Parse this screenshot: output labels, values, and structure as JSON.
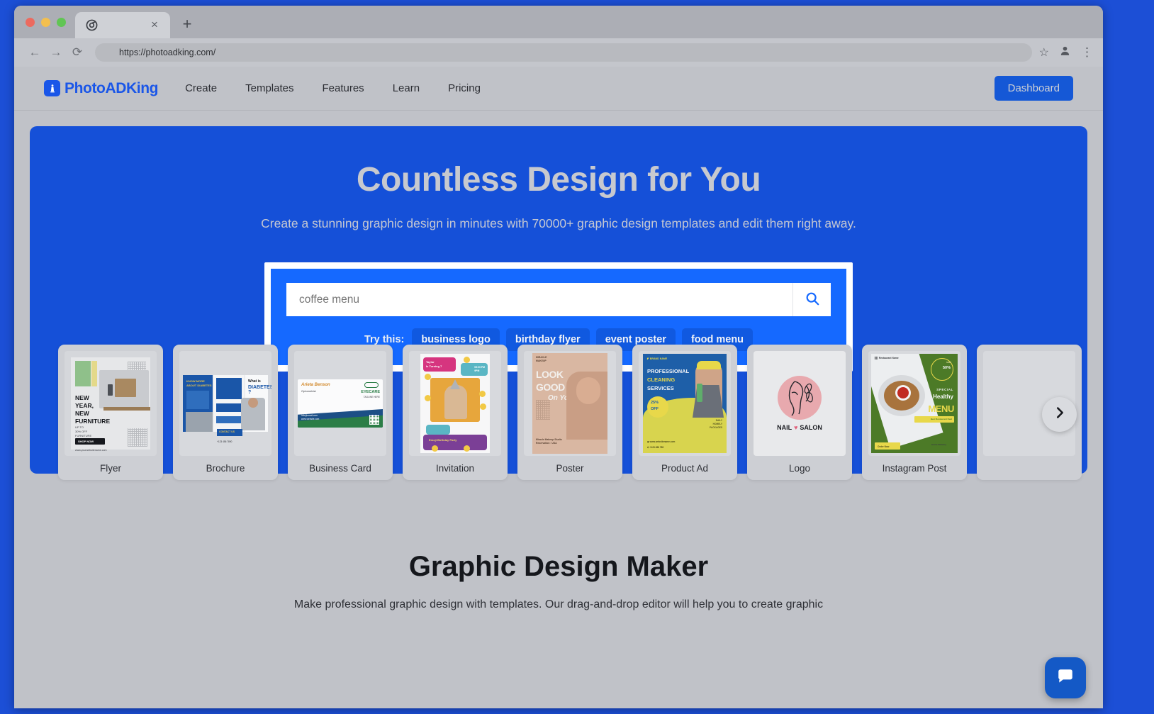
{
  "browser": {
    "tab_title_icon": "chrome-favicon",
    "url": "https://photoadking.com/",
    "back_icon": "←",
    "forward_icon": "→",
    "reload_icon": "⟳",
    "star_icon": "☆",
    "profile_icon": "person-icon",
    "menu_icon": "⋮",
    "new_tab_icon": "+",
    "close_tab_icon": "×"
  },
  "header": {
    "logo_text": "PhotoADKing",
    "logo_mark": "king-icon",
    "nav": [
      {
        "label": "Create"
      },
      {
        "label": "Templates"
      },
      {
        "label": "Features"
      },
      {
        "label": "Learn"
      },
      {
        "label": "Pricing"
      }
    ],
    "dashboard_label": "Dashboard"
  },
  "hero": {
    "title": "Countless Design for You",
    "subtitle": "Create a stunning graphic design in minutes with 70000+ graphic design templates and edit them right away.",
    "search": {
      "value": "coffee menu",
      "placeholder": "coffee menu",
      "search_icon": "search-icon",
      "try_label": "Try this:",
      "chips": [
        "business logo",
        "birthday flyer",
        "event poster",
        "food menu"
      ]
    },
    "bg_color": "#1550d8",
    "accent_color": "#1569ff"
  },
  "cards": [
    {
      "label": "Flyer",
      "art": {
        "heading": "NEW YEAR, NEW FURNITURE",
        "sub": "UP TO 30% OFF FURNITURE",
        "button": "SHOP NOW",
        "site": "www.yourwebsitename.com"
      }
    },
    {
      "label": "Brochure",
      "art": {
        "heading": "What is DIABETES ?",
        "panel": "KNOW MORE ABOUT DIABETES",
        "contact": "CONTACT US",
        "phone": "+123 456 7890"
      }
    },
    {
      "label": "Business Card",
      "art": {
        "name": "Arieta Benson",
        "role": "Optometrist",
        "brand": "EYECARE",
        "tagline": "TAGLINE HERE"
      }
    },
    {
      "label": "Invitation",
      "art": {
        "heading": "Taylor Is Turning 7",
        "time": "05:00 PM-9PM",
        "footer": "Emoji Birthday Party"
      }
    },
    {
      "label": "Poster",
      "art": {
        "heading": "LOOK GOOD",
        "script": "On You",
        "footer": "Miracle Makeup Studio"
      }
    },
    {
      "label": "Product Ad",
      "art": {
        "brand": "BRAND NAME",
        "line1": "PROFESSIONAL",
        "line2": "CLEANING",
        "line3": "SERVICES",
        "badge": "25% OFF",
        "phone": "+123 456 789"
      }
    },
    {
      "label": "Logo",
      "art": {
        "name": "NAIL",
        "name2": "SALON",
        "heart": "♥"
      }
    },
    {
      "label": "Instagram Post",
      "art": {
        "brand": "Restaurant Name",
        "badge": "SAVE 50% OFF",
        "kicker": "SPECIAL",
        "title1": "Healthy",
        "title2": "MENU",
        "ribbon": "Best Restaurant Deal",
        "cta": "Order Now",
        "note": "Home Delivery"
      }
    }
  ],
  "carousel": {
    "next_icon": "chevron-right-icon"
  },
  "lower": {
    "heading": "Graphic Design Maker",
    "paragraph": "Make professional graphic design with templates. Our drag-and-drop editor will help you to create graphic"
  },
  "chat": {
    "icon": "chat-bubble-icon"
  }
}
